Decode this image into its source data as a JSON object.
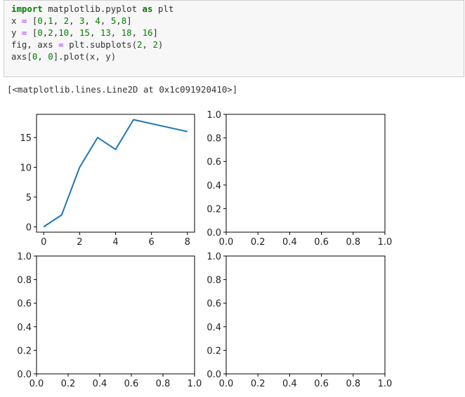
{
  "code_lines": [
    [
      {
        "t": "import",
        "c": "kw"
      },
      {
        "t": " matplotlib.pyplot "
      },
      {
        "t": "as",
        "c": "kw"
      },
      {
        "t": " plt"
      }
    ],
    [
      {
        "t": "x "
      },
      {
        "t": "=",
        "c": "op"
      },
      {
        "t": " ["
      },
      {
        "t": "0",
        "c": "num"
      },
      {
        "t": ","
      },
      {
        "t": "1",
        "c": "num"
      },
      {
        "t": ", "
      },
      {
        "t": "2",
        "c": "num"
      },
      {
        "t": ", "
      },
      {
        "t": "3",
        "c": "num"
      },
      {
        "t": ", "
      },
      {
        "t": "4",
        "c": "num"
      },
      {
        "t": ", "
      },
      {
        "t": "5",
        "c": "num"
      },
      {
        "t": ","
      },
      {
        "t": "8",
        "c": "num"
      },
      {
        "t": "]"
      }
    ],
    [
      {
        "t": "y "
      },
      {
        "t": "=",
        "c": "op"
      },
      {
        "t": " ["
      },
      {
        "t": "0",
        "c": "num"
      },
      {
        "t": ","
      },
      {
        "t": "2",
        "c": "num"
      },
      {
        "t": ","
      },
      {
        "t": "10",
        "c": "num"
      },
      {
        "t": ", "
      },
      {
        "t": "15",
        "c": "num"
      },
      {
        "t": ", "
      },
      {
        "t": "13",
        "c": "num"
      },
      {
        "t": ", "
      },
      {
        "t": "18",
        "c": "num"
      },
      {
        "t": ", "
      },
      {
        "t": "16",
        "c": "num"
      },
      {
        "t": "]"
      }
    ],
    [
      {
        "t": "fig, axs "
      },
      {
        "t": "=",
        "c": "op"
      },
      {
        "t": " plt.subplots("
      },
      {
        "t": "2",
        "c": "num"
      },
      {
        "t": ", "
      },
      {
        "t": "2",
        "c": "num"
      },
      {
        "t": ")"
      }
    ],
    [
      {
        "t": "axs["
      },
      {
        "t": "0",
        "c": "num"
      },
      {
        "t": ", "
      },
      {
        "t": "0",
        "c": "num"
      },
      {
        "t": "].plot(x, y)"
      }
    ]
  ],
  "output_text": "[<matplotlib.lines.Line2D at 0x1c091920410>]",
  "chart_data": [
    {
      "type": "line",
      "position": "top-left",
      "x": [
        0,
        1,
        2,
        3,
        4,
        5,
        8
      ],
      "y": [
        0,
        2,
        10,
        15,
        13,
        18,
        16
      ],
      "xlim": [
        -0.4,
        8.4
      ],
      "ylim": [
        -0.9,
        18.9
      ],
      "xticks": [
        "0",
        "2",
        "4",
        "6",
        "8"
      ],
      "xtick_values": [
        0,
        2,
        4,
        6,
        8
      ],
      "yticks": [
        "0",
        "5",
        "10",
        "15"
      ],
      "ytick_values": [
        0,
        5,
        10,
        15
      ],
      "color": "#1f77b4"
    },
    {
      "type": "line",
      "position": "top-right",
      "xlim": [
        0,
        1
      ],
      "ylim": [
        0,
        1
      ],
      "xticks": [
        "0.0",
        "0.2",
        "0.4",
        "0.6",
        "0.8",
        "1.0"
      ],
      "xtick_values": [
        0,
        0.2,
        0.4,
        0.6,
        0.8,
        1
      ],
      "yticks": [
        "0.0",
        "0.2",
        "0.4",
        "0.6",
        "0.8",
        "1.0"
      ],
      "ytick_values": [
        0,
        0.2,
        0.4,
        0.6,
        0.8,
        1
      ]
    },
    {
      "type": "line",
      "position": "bottom-left",
      "xlim": [
        0,
        1
      ],
      "ylim": [
        0,
        1
      ],
      "xticks": [
        "0.0",
        "0.2",
        "0.4",
        "0.6",
        "0.8",
        "1.0"
      ],
      "xtick_values": [
        0,
        0.2,
        0.4,
        0.6,
        0.8,
        1
      ],
      "yticks": [
        "0.0",
        "0.2",
        "0.4",
        "0.6",
        "0.8",
        "1.0"
      ],
      "ytick_values": [
        0,
        0.2,
        0.4,
        0.6,
        0.8,
        1
      ]
    },
    {
      "type": "line",
      "position": "bottom-right",
      "xlim": [
        0,
        1
      ],
      "ylim": [
        0,
        1
      ],
      "xticks": [
        "0.0",
        "0.2",
        "0.4",
        "0.6",
        "0.8",
        "1.0"
      ],
      "xtick_values": [
        0,
        0.2,
        0.4,
        0.6,
        0.8,
        1
      ],
      "yticks": [
        "0.0",
        "0.2",
        "0.4",
        "0.6",
        "0.8",
        "1.0"
      ],
      "ytick_values": [
        0,
        0.2,
        0.4,
        0.6,
        0.8,
        1
      ]
    }
  ]
}
